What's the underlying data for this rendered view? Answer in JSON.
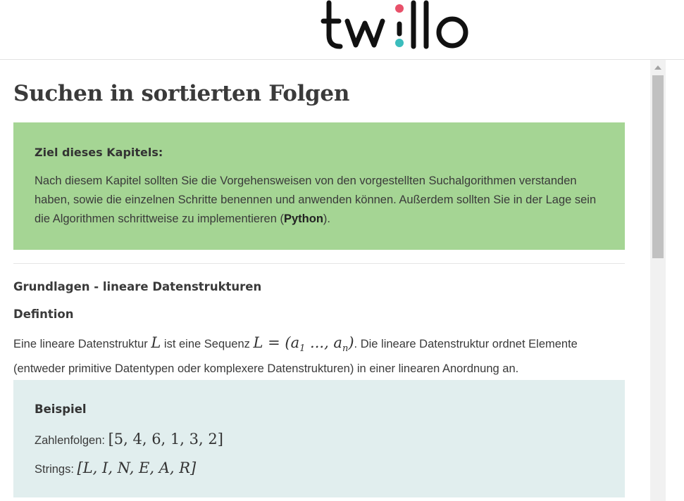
{
  "header": {
    "logo_text": "twillo"
  },
  "page": {
    "title": "Suchen in sortierten Folgen",
    "goal": {
      "heading": "Ziel dieses Kapitels:",
      "text_before": "Nach diesem Kapitel sollten Sie die Vorgehensweisen von den vorgestellten Suchalgorithmen verstanden haben, sowie die einzelnen Schritte benennen und anwenden können. Außerdem sollten Sie in der Lage sein die Algorithmen schrittweise zu implementieren (",
      "text_bold": "Python",
      "text_after": ")."
    },
    "section_title": "Grundlagen - lineare Datenstrukturen",
    "sub_title": "Defintion",
    "definition": {
      "part1": "Eine lineare Datenstruktur ",
      "math1": "L",
      "part2": " ist eine Sequenz ",
      "math2": "L = (a",
      "math2_sub1": "1",
      "math2_mid": " ..., a",
      "math2_sub2": "n",
      "math2_end": ")",
      "part3": ". Die lineare Datenstruktur ordnet Elemente (entweder primitive Datentypen oder komplexere Datenstrukturen) in einer linearen Anordnung an."
    },
    "example": {
      "heading": "Beispiel",
      "line1_label": "Zahlenfolgen: ",
      "line1_math": "[5, 4, 6, 1, 3, 2]",
      "line2_label": "Strings: ",
      "line2_math": "[L, I, N, E, A, R]"
    }
  },
  "colors": {
    "goal_box": "#a5d594",
    "example_box": "#e1eeee",
    "logo_pink": "#e8516a",
    "logo_teal": "#3bbdbd"
  }
}
